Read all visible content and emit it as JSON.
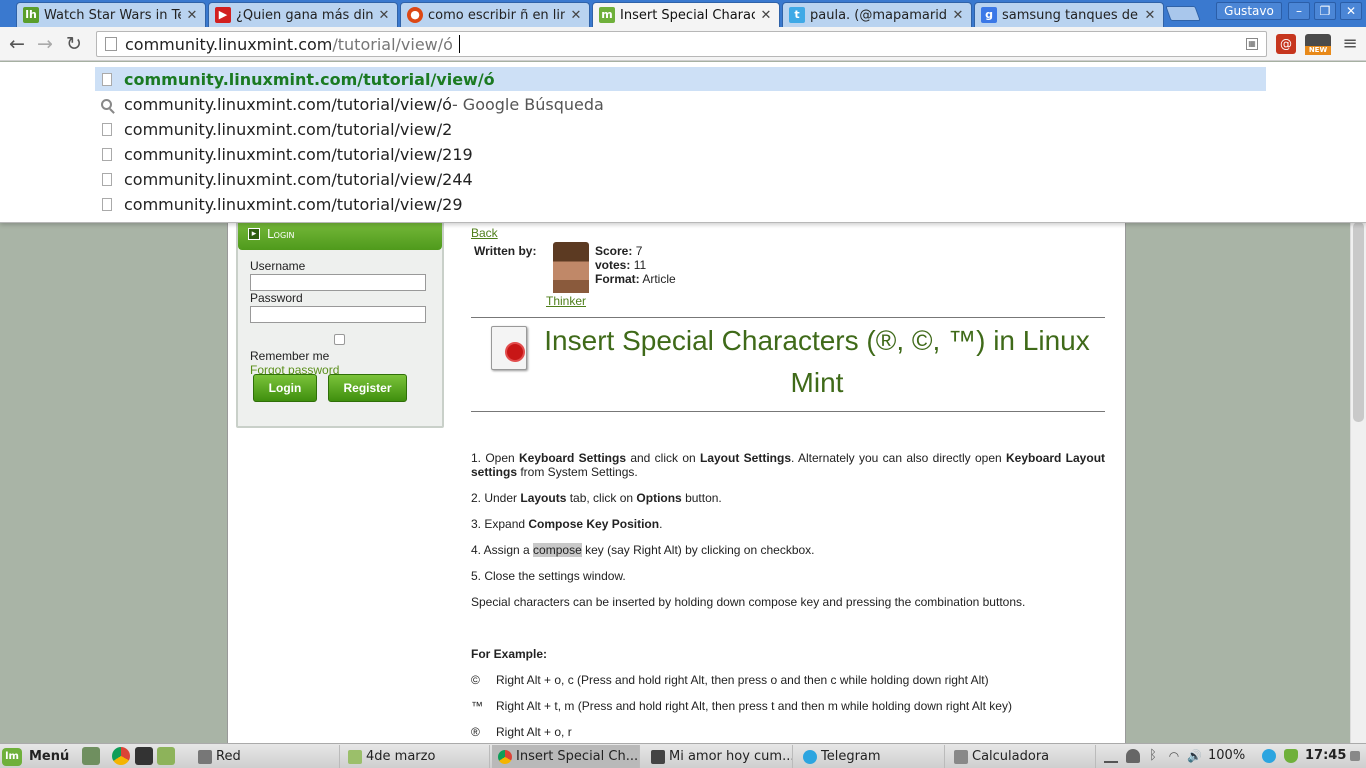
{
  "tabs": [
    {
      "title": "Watch Star Wars in Tex",
      "icon": "linuxhint-icon",
      "color": "#5a9e2a",
      "glyph": "lh"
    },
    {
      "title": "¿Quien gana más diner",
      "icon": "youtube-icon",
      "color": "#d21f1f",
      "glyph": "▶"
    },
    {
      "title": "como escribir ñ en linu",
      "icon": "ubuntu-icon",
      "color": "#dd4814",
      "glyph": "●"
    },
    {
      "title": "Insert Special Charact",
      "icon": "linuxmint-icon",
      "color": "#6fb03b",
      "glyph": "m",
      "active": true
    },
    {
      "title": "paula. (@mapamaridu",
      "icon": "twitter-icon",
      "color": "#3fa9e6",
      "glyph": "t"
    },
    {
      "title": "samsung tanques de g",
      "icon": "google-icon",
      "color": "#3b78e7",
      "glyph": "g"
    }
  ],
  "profile_name": "Gustavo",
  "omnibox": {
    "domain": "community.linuxmint.com",
    "path": "/tutorial/view/ó"
  },
  "suggestions": [
    {
      "text": "community.linuxmint.com/tutorial/view/ó",
      "suffix": "",
      "type": "page",
      "selected": true
    },
    {
      "text": "community.linuxmint.com/tutorial/view/ó",
      "suffix": " - Google Búsqueda",
      "type": "search"
    },
    {
      "text": "community.linuxmint.com/tutorial/view/2",
      "suffix": "",
      "type": "page"
    },
    {
      "text": "community.linuxmint.com/tutorial/view/219",
      "suffix": "",
      "type": "page"
    },
    {
      "text": "community.linuxmint.com/tutorial/view/244",
      "suffix": "",
      "type": "page"
    },
    {
      "text": "community.linuxmint.com/tutorial/view/29",
      "suffix": "",
      "type": "page"
    }
  ],
  "sidebar": {
    "header": "Login",
    "username_label": "Username",
    "password_label": "Password",
    "remember_label": "Remember me",
    "forgot_label": "Forgot password",
    "login_button": "Login",
    "register_button": "Register"
  },
  "article": {
    "back": "Back",
    "written_by": "Written by:",
    "author": "Thinker",
    "score_label": "Score:",
    "score": "7",
    "votes_label": "votes:",
    "votes": "11",
    "format_label": "Format:",
    "format": "Article",
    "title": "Insert Special Characters (®, ©, ™) in Linux Mint",
    "steps": {
      "s1_a": "1. Open ",
      "s1_b": "Keyboard Settings",
      "s1_c": " and click on ",
      "s1_d": "Layout Settings",
      "s1_e": ". Alternately you can also directly open ",
      "s1_f": "Keyboard Layout settings",
      "s1_g": " from System Settings.",
      "s2_a": "2. Under ",
      "s2_b": "Layouts",
      "s2_c": " tab, click on ",
      "s2_d": "Options",
      "s2_e": " button.",
      "s3_a": "3. Expand ",
      "s3_b": "Compose Key Position",
      "s3_c": ".",
      "s4_a": "4. Assign a ",
      "s4_b": "compose",
      "s4_c": " key (say Right Alt) by clicking on checkbox.",
      "s5": "5. Close the settings window."
    },
    "note": "Special characters can be inserted by holding down compose key and pressing the combination buttons.",
    "example_heading": "For Example:",
    "examples": [
      {
        "symbol": "©",
        "text": "Right Alt + o, c (Press and hold right Alt, then press o and then c while holding down right Alt)"
      },
      {
        "symbol": "™",
        "text": "Right Alt + t, m (Press and hold right Alt, then press t and then m while holding down right Alt key)"
      },
      {
        "symbol": "®",
        "text": "Right Alt + o, r"
      }
    ]
  },
  "taskbar": {
    "menu_label": "Menú",
    "tasks": [
      {
        "label": "Red",
        "icon": "network-icon"
      },
      {
        "label": "4de marzo",
        "icon": "folder-icon"
      },
      {
        "label": "Insert Special Ch...",
        "icon": "chrome-icon",
        "active": true
      },
      {
        "label": "Mi amor hoy cum...",
        "icon": "image-viewer-icon"
      },
      {
        "label": "Telegram",
        "icon": "telegram-icon"
      },
      {
        "label": "Calculadora",
        "icon": "calculator-icon"
      }
    ],
    "battery": "100%",
    "clock": "17:45"
  },
  "colors": {
    "brand_green": "#4f9a1c",
    "tab_strip": "#3a79cf",
    "link_green": "#4f7f1a",
    "title_green": "#3f6a19"
  }
}
